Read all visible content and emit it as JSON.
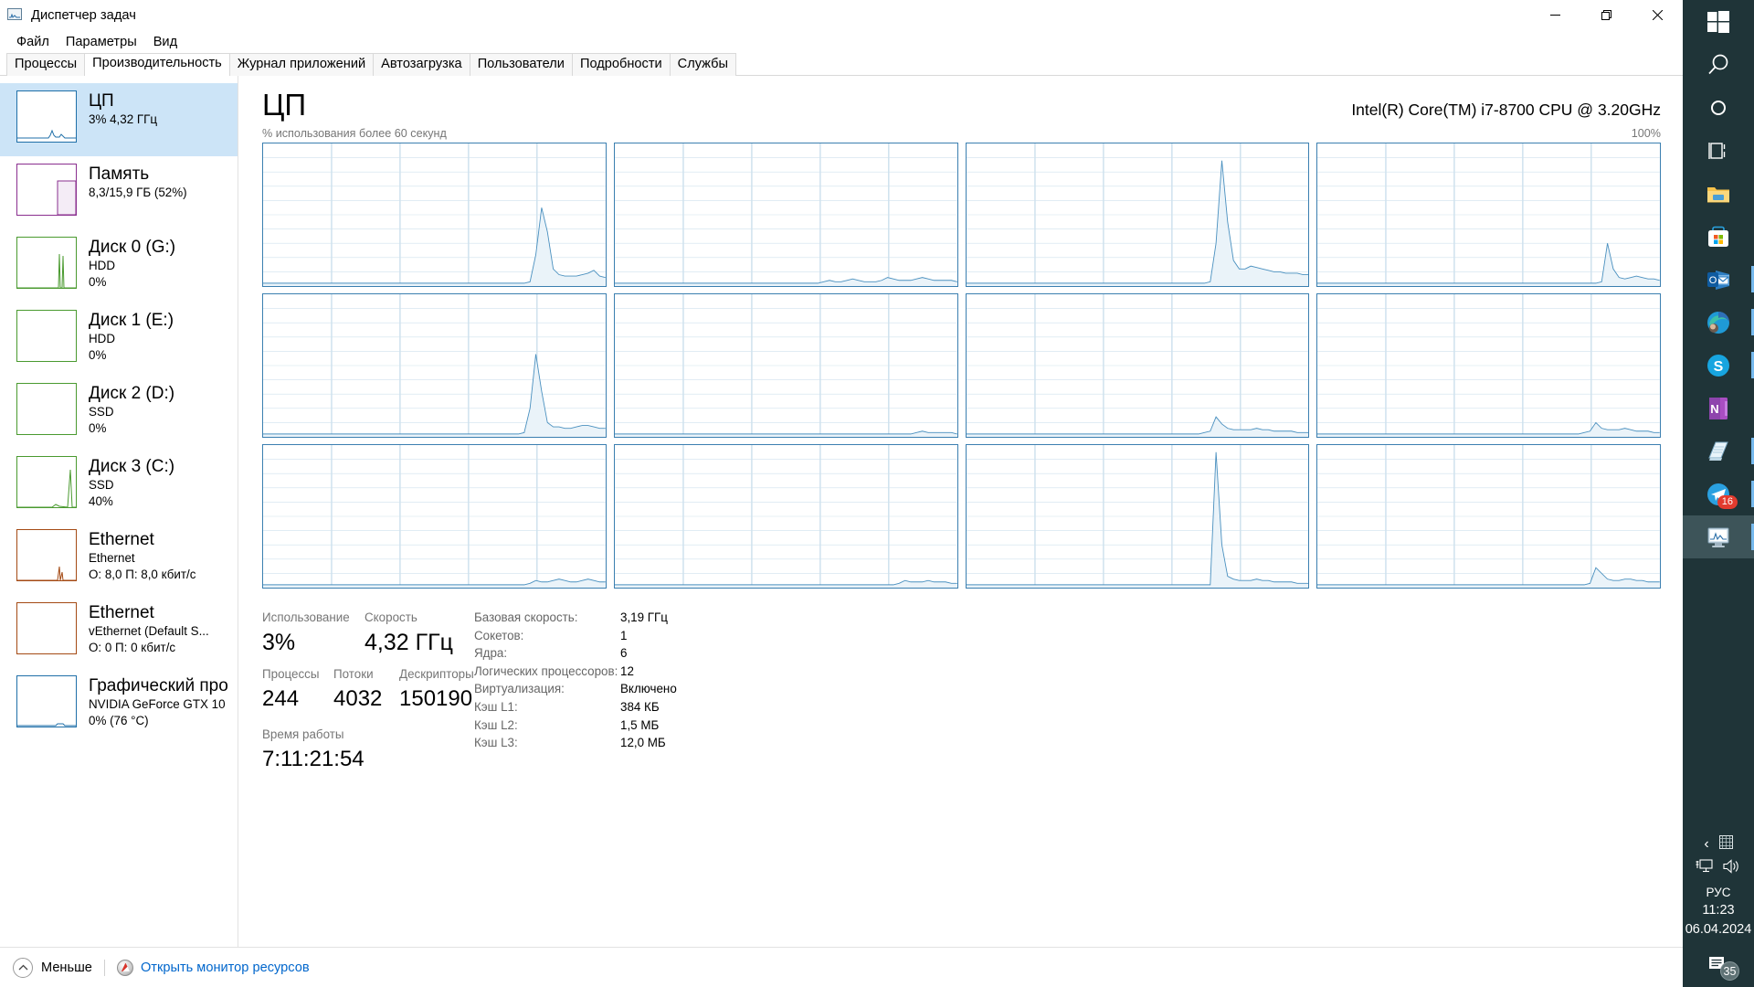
{
  "window": {
    "title": "Диспетчер задач",
    "icon": "task-manager-icon",
    "controls": {
      "minimize": "—",
      "maximize": "❐",
      "close": "✕"
    }
  },
  "menu": [
    "Файл",
    "Параметры",
    "Вид"
  ],
  "tabs": [
    {
      "label": "Процессы",
      "active": false
    },
    {
      "label": "Производительность",
      "active": true
    },
    {
      "label": "Журнал приложений",
      "active": false
    },
    {
      "label": "Автозагрузка",
      "active": false
    },
    {
      "label": "Пользователи",
      "active": false
    },
    {
      "label": "Подробности",
      "active": false
    },
    {
      "label": "Службы",
      "active": false
    }
  ],
  "sidebar": {
    "items": [
      {
        "title": "ЦП",
        "sub1": "3%  4,32 ГГц",
        "sub2": "",
        "color": "#1f6fa8",
        "selected": true
      },
      {
        "title": "Память",
        "sub1": "8,3/15,9 ГБ (52%)",
        "sub2": "",
        "color": "#8a2f8f",
        "selected": false
      },
      {
        "title": "Диск 0 (G:)",
        "sub1": "HDD",
        "sub2": "0%",
        "color": "#4a9a2f",
        "selected": false
      },
      {
        "title": "Диск 1 (E:)",
        "sub1": "HDD",
        "sub2": "0%",
        "color": "#4a9a2f",
        "selected": false
      },
      {
        "title": "Диск 2 (D:)",
        "sub1": "SSD",
        "sub2": "0%",
        "color": "#4a9a2f",
        "selected": false
      },
      {
        "title": "Диск 3 (C:)",
        "sub1": "SSD",
        "sub2": "40%",
        "color": "#4a9a2f",
        "selected": false
      },
      {
        "title": "Ethernet",
        "sub1": "Ethernet",
        "sub2": "О: 8,0 П: 8,0 кбит/с",
        "color": "#a44a14",
        "selected": false
      },
      {
        "title": "Ethernet",
        "sub1": "vEthernet (Default S...",
        "sub2": "О: 0 П: 0 кбит/с",
        "color": "#a44a14",
        "selected": false
      },
      {
        "title": "Графический про",
        "sub1": "NVIDIA GeForce GTX 10",
        "sub2": "0%  (76 °C)",
        "color": "#1f6fa8",
        "selected": false
      }
    ]
  },
  "main": {
    "heading": "ЦП",
    "model": "Intel(R) Core(TM) i7-8700 CPU @ 3.20GHz",
    "graph_label_left": "% использования более 60 секунд",
    "graph_label_right": "100%",
    "logical_processor_count": 12
  },
  "stats": {
    "left": [
      {
        "label": "Использование",
        "value": "3%"
      },
      {
        "label": "Скорость",
        "value": "4,32 ГГц"
      },
      {
        "label": "Процессы",
        "value": "244"
      },
      {
        "label": "Потоки",
        "value": "4032"
      },
      {
        "label": "Дескрипторы",
        "value": "150190"
      },
      {
        "label": "Время работы",
        "value": "7:11:21:54"
      }
    ],
    "right": [
      {
        "key": "Базовая скорость:",
        "value": "3,19 ГГц"
      },
      {
        "key": "Сокетов:",
        "value": "1"
      },
      {
        "key": "Ядра:",
        "value": "6"
      },
      {
        "key": "Логических процессоров:",
        "value": "12"
      },
      {
        "key": "Виртуализация:",
        "value": "Включено"
      },
      {
        "key": "Кэш L1:",
        "value": "384 КБ"
      },
      {
        "key": "Кэш L2:",
        "value": "1,5 МБ"
      },
      {
        "key": "Кэш L3:",
        "value": "12,0 МБ"
      }
    ]
  },
  "bottom": {
    "less_label": "Меньше",
    "resource_monitor_label": "Открыть монитор ресурсов"
  },
  "taskbar": {
    "items": [
      {
        "name": "start-button",
        "icon": "windows-logo-icon",
        "running": false
      },
      {
        "name": "search-button",
        "icon": "search-icon",
        "running": false
      },
      {
        "name": "cortana-button",
        "icon": "circle-icon",
        "running": false
      },
      {
        "name": "task-view-button",
        "icon": "task-view-icon",
        "running": false
      },
      {
        "name": "file-explorer",
        "icon": "folder-icon",
        "running": false
      },
      {
        "name": "microsoft-store",
        "icon": "store-icon",
        "running": false
      },
      {
        "name": "outlook",
        "icon": "outlook-icon",
        "running": true
      },
      {
        "name": "microsoft-edge",
        "icon": "edge-icon",
        "running": true
      },
      {
        "name": "skype",
        "icon": "skype-icon",
        "running": true
      },
      {
        "name": "onenote",
        "icon": "onenote-icon",
        "running": false
      },
      {
        "name": "notepad",
        "icon": "notepad-icon",
        "running": true
      },
      {
        "name": "telegram",
        "icon": "telegram-icon",
        "running": true,
        "badge": "16"
      },
      {
        "name": "task-manager",
        "icon": "task-manager-icon",
        "running": true,
        "active": true
      }
    ],
    "tray": {
      "chevron": "‹",
      "language": "РУС",
      "time": "11:23",
      "date": "06.04.2024",
      "notification_count": "35"
    }
  },
  "chart_data": {
    "type": "line",
    "title": "% использования более 60 секунд",
    "ylabel": "% использования",
    "xlabel": "60 секунд",
    "ylim": [
      0,
      100
    ],
    "grid": true,
    "legend_position": "none",
    "series_color": "#4a90bf",
    "fill_color": "#eaf3f9",
    "note": "12 логических процессоров, каждый график 0-100%",
    "series": [
      {
        "name": "CPU 0",
        "values": [
          2,
          2,
          2,
          2,
          2,
          2,
          2,
          2,
          2,
          2,
          2,
          2,
          2,
          2,
          2,
          2,
          2,
          2,
          2,
          2,
          2,
          2,
          2,
          2,
          2,
          2,
          2,
          2,
          2,
          2,
          2,
          2,
          2,
          2,
          2,
          2,
          2,
          2,
          2,
          2,
          2,
          2,
          2,
          2,
          2,
          2,
          3,
          22,
          55,
          38,
          12,
          8,
          7,
          7,
          7,
          8,
          9,
          11,
          7,
          6
        ]
      },
      {
        "name": "CPU 1",
        "values": [
          2,
          2,
          2,
          2,
          2,
          2,
          2,
          2,
          2,
          2,
          2,
          2,
          2,
          2,
          2,
          2,
          2,
          2,
          2,
          2,
          2,
          2,
          2,
          2,
          2,
          2,
          2,
          2,
          2,
          2,
          2,
          2,
          2,
          2,
          2,
          2,
          3,
          4,
          3,
          3,
          4,
          5,
          4,
          3,
          3,
          3,
          4,
          6,
          5,
          4,
          4,
          4,
          5,
          6,
          5,
          4,
          4,
          4,
          4,
          3
        ]
      },
      {
        "name": "CPU 2",
        "values": [
          2,
          2,
          2,
          2,
          2,
          2,
          2,
          2,
          2,
          2,
          2,
          2,
          2,
          2,
          2,
          2,
          2,
          2,
          2,
          2,
          2,
          2,
          2,
          2,
          2,
          2,
          2,
          2,
          2,
          2,
          2,
          2,
          2,
          2,
          2,
          2,
          2,
          2,
          2,
          2,
          2,
          2,
          3,
          30,
          88,
          45,
          18,
          12,
          12,
          14,
          13,
          12,
          11,
          10,
          10,
          9,
          9,
          9,
          8,
          8
        ]
      },
      {
        "name": "CPU 3",
        "values": [
          2,
          2,
          2,
          2,
          2,
          2,
          2,
          2,
          2,
          2,
          2,
          2,
          2,
          2,
          2,
          2,
          2,
          2,
          2,
          2,
          2,
          2,
          2,
          2,
          2,
          2,
          2,
          2,
          2,
          2,
          2,
          2,
          2,
          2,
          2,
          2,
          2,
          2,
          2,
          2,
          2,
          2,
          2,
          2,
          2,
          2,
          2,
          2,
          2,
          3,
          30,
          12,
          6,
          5,
          6,
          7,
          6,
          5,
          5,
          4
        ]
      },
      {
        "name": "CPU 4",
        "values": [
          2,
          2,
          2,
          2,
          2,
          2,
          2,
          2,
          2,
          2,
          2,
          2,
          2,
          2,
          2,
          2,
          2,
          2,
          2,
          2,
          2,
          2,
          2,
          2,
          2,
          2,
          2,
          2,
          2,
          2,
          2,
          2,
          2,
          2,
          2,
          2,
          2,
          2,
          2,
          2,
          2,
          2,
          2,
          2,
          2,
          3,
          20,
          58,
          32,
          10,
          7,
          7,
          6,
          6,
          7,
          8,
          8,
          7,
          6,
          6
        ]
      },
      {
        "name": "CPU 5",
        "values": [
          2,
          2,
          2,
          2,
          2,
          2,
          2,
          2,
          2,
          2,
          2,
          2,
          2,
          2,
          2,
          2,
          2,
          2,
          2,
          2,
          2,
          2,
          2,
          2,
          2,
          2,
          2,
          2,
          2,
          2,
          2,
          2,
          2,
          2,
          2,
          2,
          2,
          2,
          2,
          2,
          2,
          2,
          2,
          2,
          2,
          2,
          2,
          2,
          2,
          2,
          2,
          2,
          3,
          4,
          3,
          3,
          3,
          3,
          3,
          2
        ]
      },
      {
        "name": "CPU 6",
        "values": [
          2,
          2,
          2,
          2,
          2,
          2,
          2,
          2,
          2,
          2,
          2,
          2,
          2,
          2,
          2,
          2,
          2,
          2,
          2,
          2,
          2,
          2,
          2,
          2,
          2,
          2,
          2,
          2,
          2,
          2,
          2,
          2,
          2,
          2,
          2,
          2,
          2,
          2,
          2,
          2,
          2,
          3,
          4,
          14,
          9,
          6,
          5,
          5,
          5,
          5,
          6,
          5,
          5,
          4,
          4,
          4,
          4,
          3,
          3,
          3
        ]
      },
      {
        "name": "CPU 7",
        "values": [
          2,
          2,
          2,
          2,
          2,
          2,
          2,
          2,
          2,
          2,
          2,
          2,
          2,
          2,
          2,
          2,
          2,
          2,
          2,
          2,
          2,
          2,
          2,
          2,
          2,
          2,
          2,
          2,
          2,
          2,
          2,
          2,
          2,
          2,
          2,
          2,
          2,
          2,
          2,
          2,
          2,
          2,
          2,
          2,
          2,
          2,
          3,
          4,
          10,
          6,
          5,
          5,
          5,
          6,
          5,
          4,
          4,
          4,
          3,
          3
        ]
      },
      {
        "name": "CPU 8",
        "values": [
          2,
          2,
          2,
          2,
          2,
          2,
          2,
          2,
          2,
          2,
          2,
          2,
          2,
          2,
          2,
          2,
          2,
          2,
          2,
          2,
          2,
          2,
          2,
          2,
          2,
          2,
          2,
          2,
          2,
          2,
          2,
          2,
          2,
          2,
          2,
          2,
          2,
          2,
          2,
          2,
          2,
          2,
          2,
          2,
          2,
          2,
          3,
          5,
          4,
          4,
          5,
          6,
          5,
          4,
          4,
          5,
          6,
          5,
          4,
          4
        ]
      },
      {
        "name": "CPU 9",
        "values": [
          2,
          2,
          2,
          2,
          2,
          2,
          2,
          2,
          2,
          2,
          2,
          2,
          2,
          2,
          2,
          2,
          2,
          2,
          2,
          2,
          2,
          2,
          2,
          2,
          2,
          2,
          2,
          2,
          2,
          2,
          2,
          2,
          2,
          2,
          2,
          2,
          2,
          2,
          2,
          2,
          2,
          2,
          2,
          2,
          2,
          2,
          2,
          2,
          2,
          3,
          5,
          4,
          4,
          4,
          5,
          4,
          4,
          4,
          3,
          3
        ]
      },
      {
        "name": "CPU 10",
        "values": [
          2,
          2,
          2,
          2,
          2,
          2,
          2,
          2,
          2,
          2,
          2,
          2,
          2,
          2,
          2,
          2,
          2,
          2,
          2,
          2,
          2,
          2,
          2,
          2,
          2,
          2,
          2,
          2,
          2,
          2,
          2,
          2,
          2,
          2,
          2,
          2,
          2,
          2,
          2,
          2,
          2,
          2,
          2,
          95,
          30,
          8,
          6,
          5,
          5,
          5,
          6,
          5,
          5,
          4,
          4,
          4,
          4,
          3,
          3,
          3
        ]
      },
      {
        "name": "CPU 11",
        "values": [
          2,
          2,
          2,
          2,
          2,
          2,
          2,
          2,
          2,
          2,
          2,
          2,
          2,
          2,
          2,
          2,
          2,
          2,
          2,
          2,
          2,
          2,
          2,
          2,
          2,
          2,
          2,
          2,
          2,
          2,
          2,
          2,
          2,
          2,
          2,
          2,
          2,
          2,
          2,
          2,
          2,
          2,
          2,
          2,
          2,
          2,
          2,
          3,
          14,
          10,
          6,
          5,
          5,
          6,
          6,
          5,
          5,
          4,
          4,
          4
        ]
      }
    ]
  }
}
